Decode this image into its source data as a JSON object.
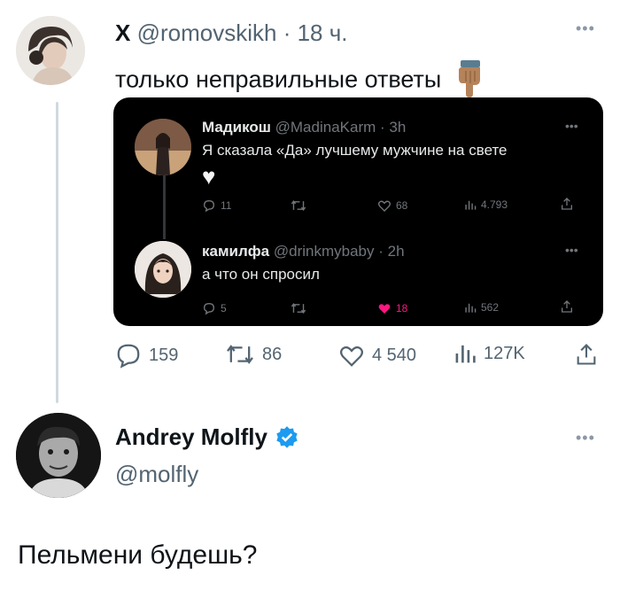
{
  "tweet1": {
    "platform_mark": "X",
    "handle": "@romovskikh",
    "separator": "·",
    "time": "18 ч.",
    "text": "только неправильные ответы",
    "emoji_icon": "backhand-index-pointing-down-icon"
  },
  "embed": {
    "reply1": {
      "name": "Мадикош",
      "handle": "@MadinaKarm",
      "time": "· 3h",
      "text": "Я сказала «Да» лучшему мужчине на свете",
      "heart": "♥",
      "replies": "11",
      "likes": "68",
      "views": "4.793"
    },
    "reply2": {
      "name": "камилфа",
      "handle": "@drinkmybaby",
      "time": "· 2h",
      "text": "а что он спросил",
      "replies": "5",
      "likes": "18",
      "views": "562"
    },
    "colors": {
      "background": "#000000",
      "like_active": "#f91880"
    }
  },
  "actions": {
    "replies": "159",
    "retweets": "86",
    "likes": "4 540",
    "views": "127K"
  },
  "tweet2": {
    "name": "Andrey Molfly",
    "handle": "@molfly",
    "text": "Пельмени будешь?",
    "verified_color": "#1d9bf0"
  }
}
